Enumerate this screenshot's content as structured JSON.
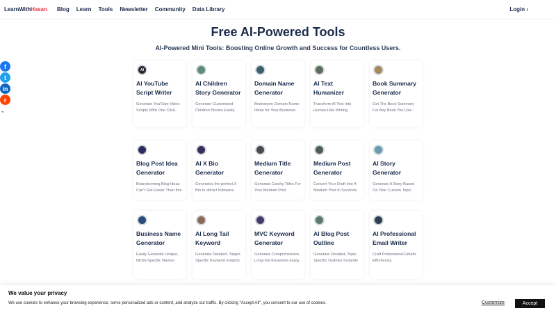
{
  "nav": {
    "logo_part1": "LearnWith",
    "logo_part2": "Hasan",
    "links": [
      "Blog",
      "Learn",
      "Tools",
      "Newsletter",
      "Community",
      "Data Library"
    ],
    "login": "Login ›"
  },
  "header": {
    "title": "Free AI-Powered Tools",
    "subtitle": "AI-Powered Mini Tools: Boosting Online Growth and Success for Countless Users."
  },
  "social": [
    {
      "name": "facebook-icon",
      "glyph": "f"
    },
    {
      "name": "twitter-icon",
      "glyph": "t"
    },
    {
      "name": "linkedin-icon",
      "glyph": "in"
    },
    {
      "name": "reddit-icon",
      "glyph": "r"
    }
  ],
  "tools": [
    {
      "title": "AI YouTube Script Writer",
      "desc": "Generate YouTube Video Scripts With One Click.",
      "icon": "ai-icon",
      "color": "#2a2233",
      "glyph": "AI"
    },
    {
      "title": "AI Children Story Generator",
      "desc": "Generate Customized Children Stories Easily.",
      "icon": "children-story-icon",
      "color": "#5d8a7a",
      "glyph": ""
    },
    {
      "title": "Domain Name Generator",
      "desc": "Brainstorm Domain Name Ideas for Your Business.",
      "icon": "domain-icon",
      "color": "#3f5f6e",
      "glyph": ""
    },
    {
      "title": "AI Text Humanizer",
      "desc": "Transform AI Text Into Human-Like Writing.",
      "icon": "humanizer-icon",
      "color": "#5b6e5a",
      "glyph": ""
    },
    {
      "title": "Book Summary Generator",
      "desc": "Get The Book Summary For Any Book You Like.",
      "icon": "book-icon",
      "color": "#a8875a",
      "glyph": ""
    },
    {
      "title": "Blog Post Idea Generator",
      "desc": "Brainstorming Blog Ideas Can't Get Easier Than this.",
      "icon": "blog-idea-icon",
      "color": "#2e2b5c",
      "glyph": ""
    },
    {
      "title": "AI X Bio Generator",
      "desc": "Generates the perfect X Bio to attract followers.",
      "icon": "x-bio-icon",
      "color": "#38305a",
      "glyph": ""
    },
    {
      "title": "Medium Title Generator",
      "desc": "Generate Catchy Titles For Your Medium Post.",
      "icon": "medium-title-icon",
      "color": "#4a4a4a",
      "glyph": ""
    },
    {
      "title": "Medium Post Generator",
      "desc": "Convert Your Draft Into A Medium Post In Seconds.",
      "icon": "medium-post-icon",
      "color": "#4d5e54",
      "glyph": ""
    },
    {
      "title": "AI Story Generator",
      "desc": "Generate A Story Based On Your Custom Topic.",
      "icon": "story-icon",
      "color": "#6a9bb0",
      "glyph": ""
    },
    {
      "title": "Business Name Generator",
      "desc": "Easily Generate Unique, Niche-Specific Names.",
      "icon": "business-name-icon",
      "color": "#2a4a78",
      "glyph": ""
    },
    {
      "title": "AI Long Tail Keyword",
      "desc": "Generate Detailed, Target-Specific Keyword Insights.",
      "icon": "long-tail-icon",
      "color": "#8a6b55",
      "glyph": ""
    },
    {
      "title": "MVC Keyword Generator",
      "desc": "Generate Comprehensive, Long-Tail Keywords easily",
      "icon": "mvc-keyword-icon",
      "color": "#463a6a",
      "glyph": ""
    },
    {
      "title": "AI Blog Post Outline",
      "desc": "Generate Detailed, Topic-Specific Outlines Instantly",
      "icon": "outline-icon",
      "color": "#5b7a6e",
      "glyph": ""
    },
    {
      "title": "AI Professional Email Writer",
      "desc": "Craft Professional Emails Effortlessly.",
      "icon": "email-icon",
      "color": "#2f3e50",
      "glyph": ""
    }
  ],
  "cookie": {
    "title": "We value your privacy",
    "text": "We use cookies to enhance your browsing experience, serve personalized ads or content, and analyze our traffic. By clicking \"Accept All\", you consent to our use of cookies.",
    "customize": "Customize",
    "accept": "Accept"
  }
}
